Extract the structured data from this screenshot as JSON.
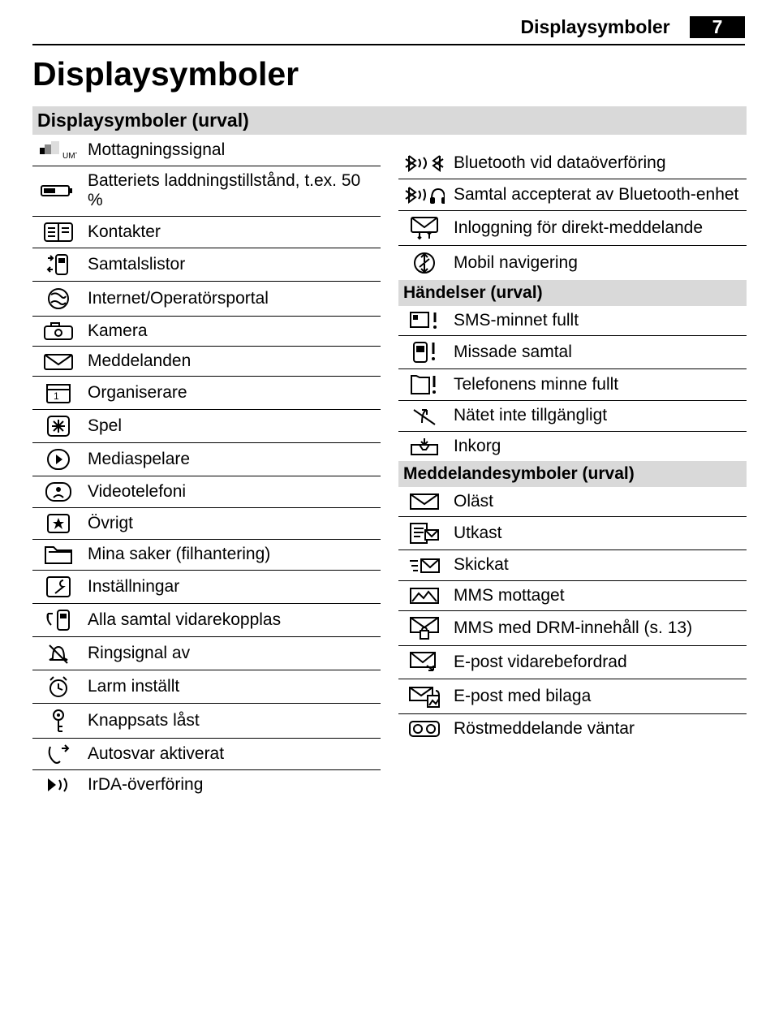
{
  "running_head": {
    "label": "Displaysymboler",
    "page": "7"
  },
  "title": "Displaysymboler",
  "subhead_left": "Displaysymboler (urval)",
  "left_items": [
    "Mottagningssignal",
    "Batteriets laddningstillstånd, t.ex. 50 %",
    "Kontakter",
    "Samtalslistor",
    "Internet/Operatörsportal",
    "Kamera",
    "Meddelanden",
    "Organiserare",
    "Spel",
    "Mediaspelare",
    "Videotelefoni",
    "Övrigt",
    "Mina saker (filhantering)",
    "Inställningar",
    "Alla samtal vidarekopplas",
    "Ringsignal av",
    "Larm inställt",
    "Knappsats låst",
    "Autosvar aktiverat",
    "IrDA-överföring"
  ],
  "right_top_items": [
    "Bluetooth vid dataöverföring",
    "Samtal accepterat av Bluetooth-enhet",
    "Inloggning för direkt-meddelande",
    "Mobil navigering"
  ],
  "subhead_events": "Händelser (urval)",
  "events_items": [
    "SMS-minnet fullt",
    "Missade samtal",
    "Telefonens minne fullt",
    "Nätet inte tillgängligt",
    "Inkorg"
  ],
  "subhead_msg": "Meddelandesymboler (urval)",
  "msg_items": [
    "Oläst",
    "Utkast",
    "Skickat",
    "MMS mottaget",
    "MMS med DRM-innehåll (s. 13)",
    "E-post vidarebefordrad",
    "E-post med bilaga",
    "Röstmeddelande väntar"
  ]
}
